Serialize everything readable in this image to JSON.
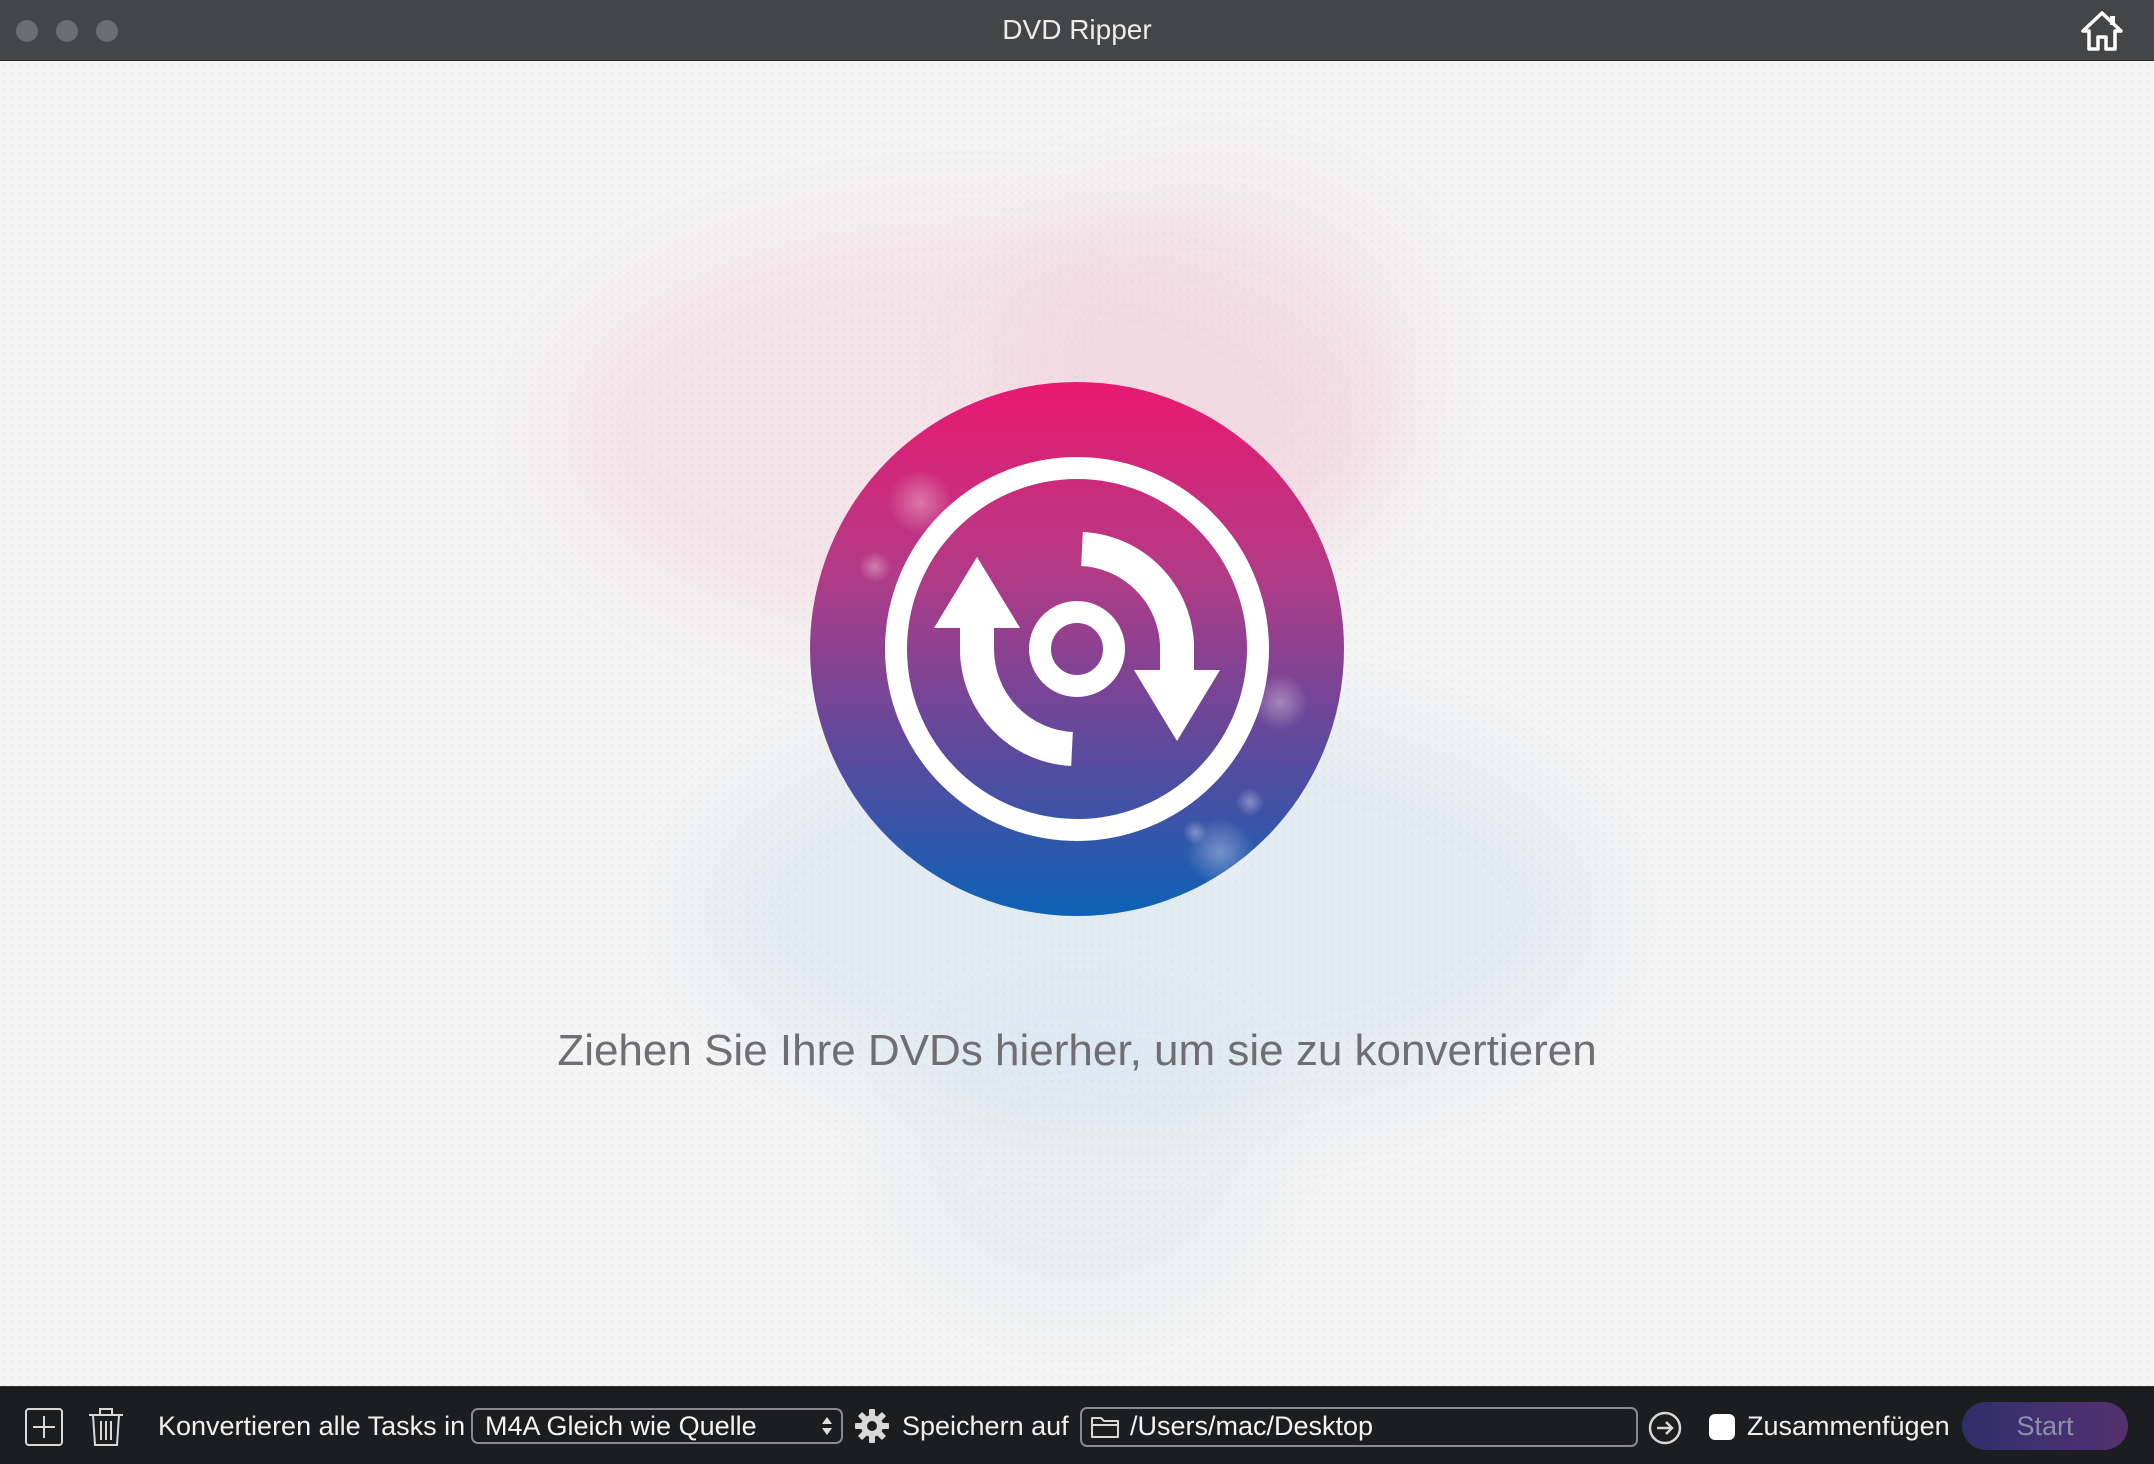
{
  "window": {
    "title": "DVD Ripper"
  },
  "main": {
    "drop_hint": "Ziehen Sie Ihre DVDs hierher, um sie zu konvertieren"
  },
  "toolbar": {
    "convert_label": "Konvertieren alle Tasks in",
    "format_value": "M4A Gleich wie Quelle",
    "save_label": "Speichern auf",
    "save_path": "/Users/mac/Desktop",
    "merge_label": "Zusammenfügen",
    "merge_checked": false,
    "start_label": "Start"
  },
  "icons": {
    "home": "home-icon",
    "add": "plus-icon",
    "delete": "trash-icon",
    "settings": "gear-icon",
    "folder": "folder-icon",
    "open_folder": "arrow-right-circle-icon",
    "disc": "dvd-convert-icon"
  },
  "colors": {
    "titlebar": "#444547",
    "toolbar": "#1c1d1f",
    "disc_top": "#e8186f",
    "disc_bottom": "#0e5fb4",
    "start_button": "#3a2f6e"
  }
}
